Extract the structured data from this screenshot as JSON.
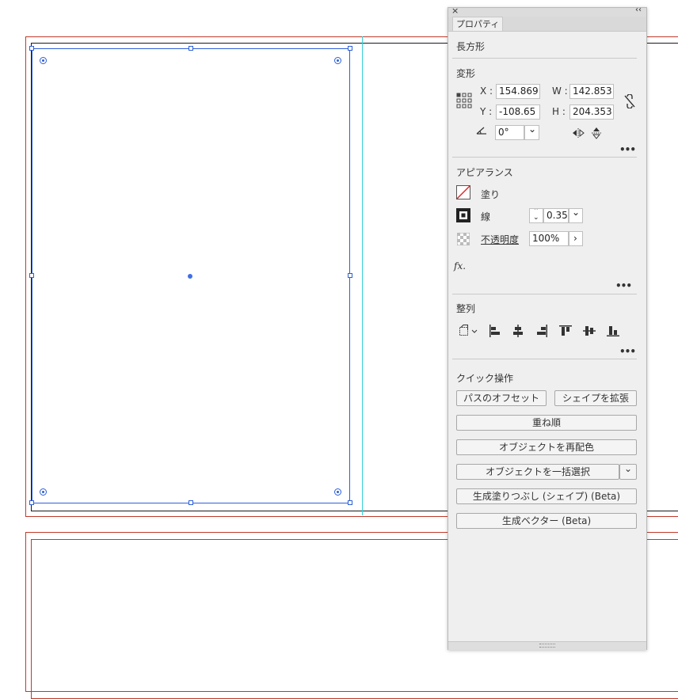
{
  "panel": {
    "close_glyph": "×",
    "collapse_glyph": "‹‹",
    "tab_label": "プロパティ",
    "object_type": "長方形",
    "transform": {
      "title": "変形",
      "x_label": "X :",
      "x_value": "154.869",
      "y_label": "Y :",
      "y_value": "-108.65",
      "w_label": "W :",
      "w_value": "142.853",
      "h_label": "H :",
      "h_value": "204.353",
      "angle_value": "0°"
    },
    "appearance": {
      "title": "アピアランス",
      "fill_label": "塗り",
      "stroke_label": "線",
      "stroke_value": "0.35",
      "opacity_label": "不透明度",
      "opacity_value": "100%",
      "fx_label": "fx."
    },
    "align": {
      "title": "整列"
    },
    "quick_actions": {
      "title": "クイック操作",
      "offset_path": "パスのオフセット",
      "expand_shape": "シェイプを拡張",
      "arrange": "重ね順",
      "recolor": "オブジェクトを再配色",
      "select_same": "オブジェクトを一括選択",
      "gen_fill": "生成塗りつぶし (シェイプ) (Beta)",
      "gen_vector": "生成ベクター (Beta)"
    },
    "more_glyph": "•••",
    "chevron_down": "⌄",
    "chevron_right": "›"
  },
  "colors": {
    "artboard_bleed": "#c0392b",
    "selection": "#2e5fd6",
    "guide": "#33d0d6"
  }
}
